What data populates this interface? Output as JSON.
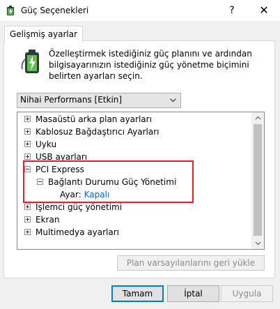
{
  "window": {
    "title": "Güç Seçenekleri",
    "help_glyph": "?",
    "close_glyph": "✕"
  },
  "tab": {
    "label": "Gelişmiş ayarlar"
  },
  "description": "Özelleştirmek istediğiniz güç planını ve ardından bilgisayarınızın istediğiniz güç yönetme biçimini belirten ayarları seçin.",
  "plan_dropdown": {
    "selected": "Nihai Performans [Etkin]"
  },
  "tree": [
    {
      "label": "Masaüstü arka plan ayarları",
      "state": "collapsed",
      "level": 0
    },
    {
      "label": "Kablosuz Bağdaştırıcı Ayarları",
      "state": "collapsed",
      "level": 0
    },
    {
      "label": "Uyku",
      "state": "collapsed",
      "level": 0
    },
    {
      "label": "USB ayarları",
      "state": "collapsed",
      "level": 0
    },
    {
      "label": "PCI Express",
      "state": "expanded",
      "level": 0
    },
    {
      "label": "Bağlantı Durumu Güç Yönetimi",
      "state": "expanded",
      "level": 1
    },
    {
      "label": "Ayar:",
      "value": "Kapalı",
      "level": 2
    },
    {
      "label": "İşlemci güç yönetimi",
      "state": "collapsed",
      "level": 0
    },
    {
      "label": "Ekran",
      "state": "collapsed",
      "level": 0
    },
    {
      "label": "Multimedya ayarları",
      "state": "collapsed",
      "level": 0
    }
  ],
  "buttons": {
    "restore_defaults": "Plan varsayılanlarını geri yükle",
    "ok": "Tamam",
    "cancel": "İptal",
    "apply": "Uygula"
  },
  "colors": {
    "highlight": "#e21f26",
    "link": "#0066cc"
  }
}
